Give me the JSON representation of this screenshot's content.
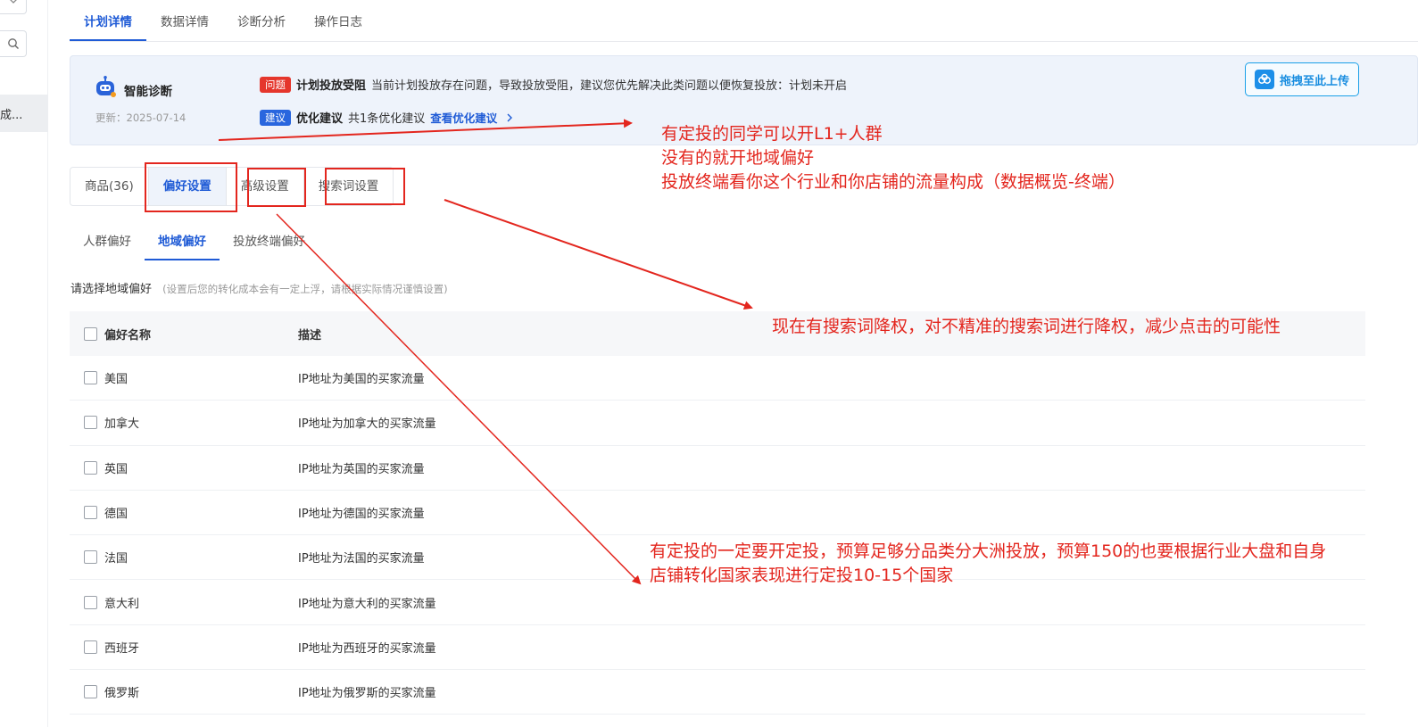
{
  "sidebar": {
    "item_label": "成..."
  },
  "top_tabs": [
    {
      "label": "计划详情",
      "active": true
    },
    {
      "label": "数据详情",
      "active": false
    },
    {
      "label": "诊断分析",
      "active": false
    },
    {
      "label": "操作日志",
      "active": false
    }
  ],
  "diagnosis": {
    "title": "智能诊断",
    "updated": "更新：2025-07-14",
    "issue": {
      "tag": "问题",
      "title": "计划投放受阻",
      "text": "当前计划投放存在问题，导致投放受阻，建议您优先解决此类问题以便恢复投放：计划未开启"
    },
    "suggestion": {
      "tag": "建议",
      "title": "优化建议",
      "text": "共1条优化建议",
      "link": "查看优化建议"
    },
    "upload_label": "拖拽至此上传"
  },
  "segment_tabs": [
    {
      "label": "商品(36)",
      "active": false
    },
    {
      "label": "偏好设置",
      "active": true
    },
    {
      "label": "高级设置",
      "active": false
    },
    {
      "label": "搜索词设置",
      "active": false
    }
  ],
  "sub_tabs": [
    {
      "label": "人群偏好",
      "active": false
    },
    {
      "label": "地域偏好",
      "active": true
    },
    {
      "label": "投放终端偏好",
      "active": false
    }
  ],
  "region": {
    "label": "请选择地域偏好",
    "hint": "(设置后您的转化成本会有一定上浮，请根据实际情况谨慎设置)"
  },
  "table": {
    "headers": {
      "name": "偏好名称",
      "desc": "描述"
    },
    "rows": [
      {
        "name": "美国",
        "desc": "IP地址为美国的买家流量"
      },
      {
        "name": "加拿大",
        "desc": "IP地址为加拿大的买家流量"
      },
      {
        "name": "英国",
        "desc": "IP地址为英国的买家流量"
      },
      {
        "name": "德国",
        "desc": "IP地址为德国的买家流量"
      },
      {
        "name": "法国",
        "desc": "IP地址为法国的买家流量"
      },
      {
        "name": "意大利",
        "desc": "IP地址为意大利的买家流量"
      },
      {
        "name": "西班牙",
        "desc": "IP地址为西班牙的买家流量"
      },
      {
        "name": "俄罗斯",
        "desc": "IP地址为俄罗斯的买家流量"
      }
    ]
  },
  "annotations": {
    "note1": [
      "有定投的同学可以开L1+人群",
      "没有的就开地域偏好",
      "投放终端看你这个行业和你店铺的流量构成（数据概览-终端）"
    ],
    "note2": "现在有搜索词降权，对不精准的搜索词进行降权，减少点击的可能性",
    "note3": [
      "有定投的一定要开定投，预算足够分品类分大洲投放，预算150的也要根据行业大盘和自身",
      "店铺转化国家表现进行定投10-15个国家"
    ]
  },
  "colors": {
    "accent": "#1f5bd6",
    "annotation": "#e3261e",
    "issue_tag": "#e5362c",
    "suggest_tag": "#2966de",
    "banner_bg": "#eef3fb"
  }
}
